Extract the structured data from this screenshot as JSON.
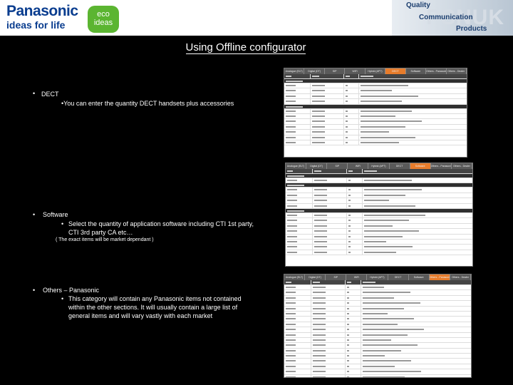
{
  "header": {
    "brand": "Panasonic",
    "tagline": "ideas for life",
    "eco_line1": "eco",
    "eco_line2": "ideas",
    "right_quality": "Quality",
    "right_communication": "Communication",
    "right_products": "Products",
    "right_mark": "PSNUK"
  },
  "slide": {
    "title": "Using Offline configurator"
  },
  "bullets": {
    "dect_heading": "DECT",
    "dect_sub": "•You can enter the quantity DECT handsets plus accessories",
    "software_heading": "Software",
    "software_sub1": "Select the quantity of application software including CTI 1st party,",
    "software_sub2": "CTI 3rd party CA etc…",
    "software_note": "( The exact items will be market dependant )",
    "others_heading": "Others – Panasonic",
    "others_sub1": "This category will contain any Panasonic items not contained",
    "others_sub2": "within the other sections. It will usually contain a large list of",
    "others_sub3": "general items and will vary vastly with each market"
  },
  "screens": {
    "dect_tabs": [
      "Analogue (ELT)",
      "Digital (DT)",
      "SIP",
      "WiFi",
      "Hybrid (APT)",
      "DECT",
      "Software",
      "Others - Panasonic",
      "Others - Dealer"
    ],
    "software_tabs": [
      "Analogue (ELT)",
      "Digital (DT)",
      "SIP",
      "WiFi",
      "Hybrid (APT)",
      "DECT",
      "Software",
      "Others - Panasonic",
      "Others - Dealer"
    ],
    "others_tabs": [
      "Analogue (ELT)",
      "Digital (DT)",
      "SIP",
      "WiFi",
      "Hybrid (APT)",
      "DECT",
      "Software",
      "Others - Panasonic",
      "Others - Dealer"
    ],
    "dect_active": "DECT",
    "software_active": "Software",
    "others_active": "Others - Panasonic"
  },
  "colors": {
    "background": "#000000",
    "brand_blue": "#0a3d8f",
    "eco_green": "#5bb531",
    "active_tab": "#e77c2b"
  }
}
